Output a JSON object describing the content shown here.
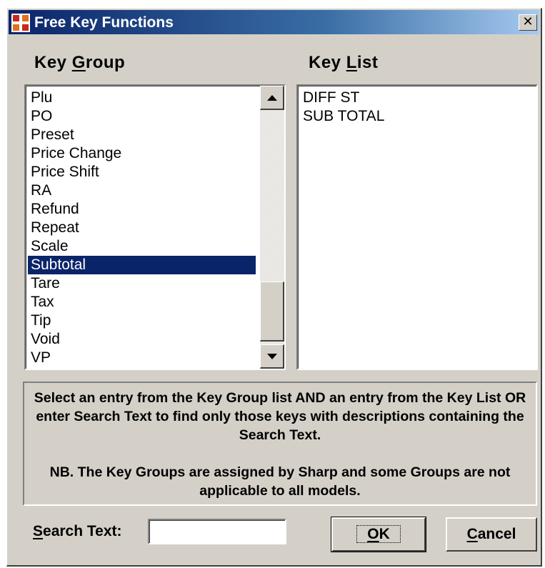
{
  "window": {
    "title": "Free Key Functions",
    "close_symbol": "✕",
    "app_icon": "sharp-app-icon"
  },
  "key_group": {
    "label_pre": "Key ",
    "label_accel": "G",
    "label_post": "roup",
    "items": [
      "Plu",
      "PO",
      "Preset",
      "Price Change",
      "Price Shift",
      "RA",
      "Refund",
      "Repeat",
      "Scale",
      "Subtotal",
      "Tare",
      "Tax",
      "Tip",
      "Void",
      "VP"
    ],
    "selected": "Subtotal",
    "scroll_up_icon": "arrow-up-icon",
    "scroll_down_icon": "arrow-down-icon"
  },
  "key_list": {
    "label_pre": "Key ",
    "label_accel": "L",
    "label_post": "ist",
    "items": [
      "DIFF ST",
      "SUB TOTAL"
    ]
  },
  "info": {
    "paragraph1": "Select an entry from the Key Group list AND an entry from the Key List OR enter Search Text to find only those keys with descriptions containing the Search Text.",
    "paragraph2": "NB. The Key Groups are assigned by Sharp and some Groups are not applicable to all models."
  },
  "search": {
    "label_accel": "S",
    "label_post": "earch Text:",
    "value": ""
  },
  "buttons": {
    "ok_accel": "O",
    "ok_post": "K",
    "cancel_accel": "C",
    "cancel_post": "ancel"
  },
  "colors": {
    "dialog_face": "#d4d0c8",
    "titlebar_start": "#0a246a",
    "titlebar_end": "#a6caf0",
    "selection": "#0a246a"
  }
}
